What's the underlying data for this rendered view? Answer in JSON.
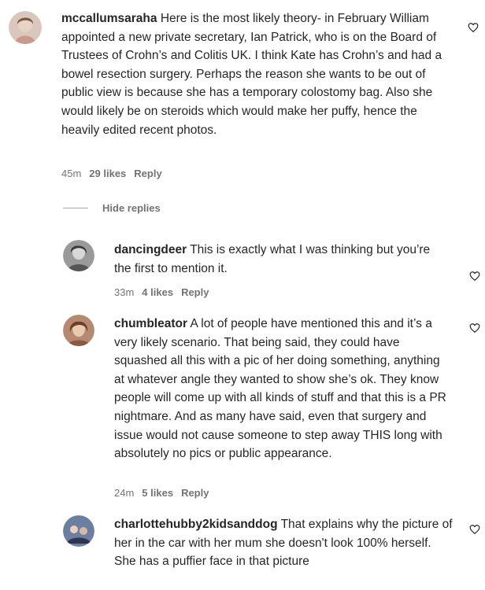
{
  "comments": [
    {
      "username": "mccallumsaraha",
      "text": "Here is the most likely theory- in February William appointed a new private secretary, Ian Patrick, who is on the Board of Trustees of Crohn’s and Colitis UK. I think Kate has Crohn’s and had a bowel resection surgery. Perhaps the reason she wants to be out of public view is because she has a temporary colostomy bag. Also she would likely be on steroids which would make her puffy, hence the heavily edited recent photos.",
      "time": "45m",
      "likes": "29 likes",
      "reply_label": "Reply"
    }
  ],
  "hide_replies_label": "Hide replies",
  "replies": [
    {
      "username": "dancingdeer",
      "text": "This is exactly what I was thinking but you’re the first to mention it.",
      "time": "33m",
      "likes": "4 likes",
      "reply_label": "Reply"
    },
    {
      "username": "chumbleator",
      "text": "A lot of people have mentioned this and it’s a very likely scenario. That being said, they could have squashed all this with a pic of her doing something, anything at whatever angle they wanted to show she’s ok. They know people will come up with all kinds of stuff and that this is a PR nightmare. And as many have said, even that surgery and issue would not cause someone to step away THIS long with absolutely no pics or public appearance.",
      "time": "24m",
      "likes": "5 likes",
      "reply_label": "Reply"
    },
    {
      "username": "charlottehubby2kidsanddog",
      "text": "That explains why the picture of her in the car with her mum she doesn't look 100% herself. She has a puffier face in that picture"
    }
  ],
  "icons": {
    "like": "heart-outline-icon"
  },
  "colors": {
    "text": "#262626",
    "meta": "#737373",
    "divider": "#a8a8a8"
  }
}
